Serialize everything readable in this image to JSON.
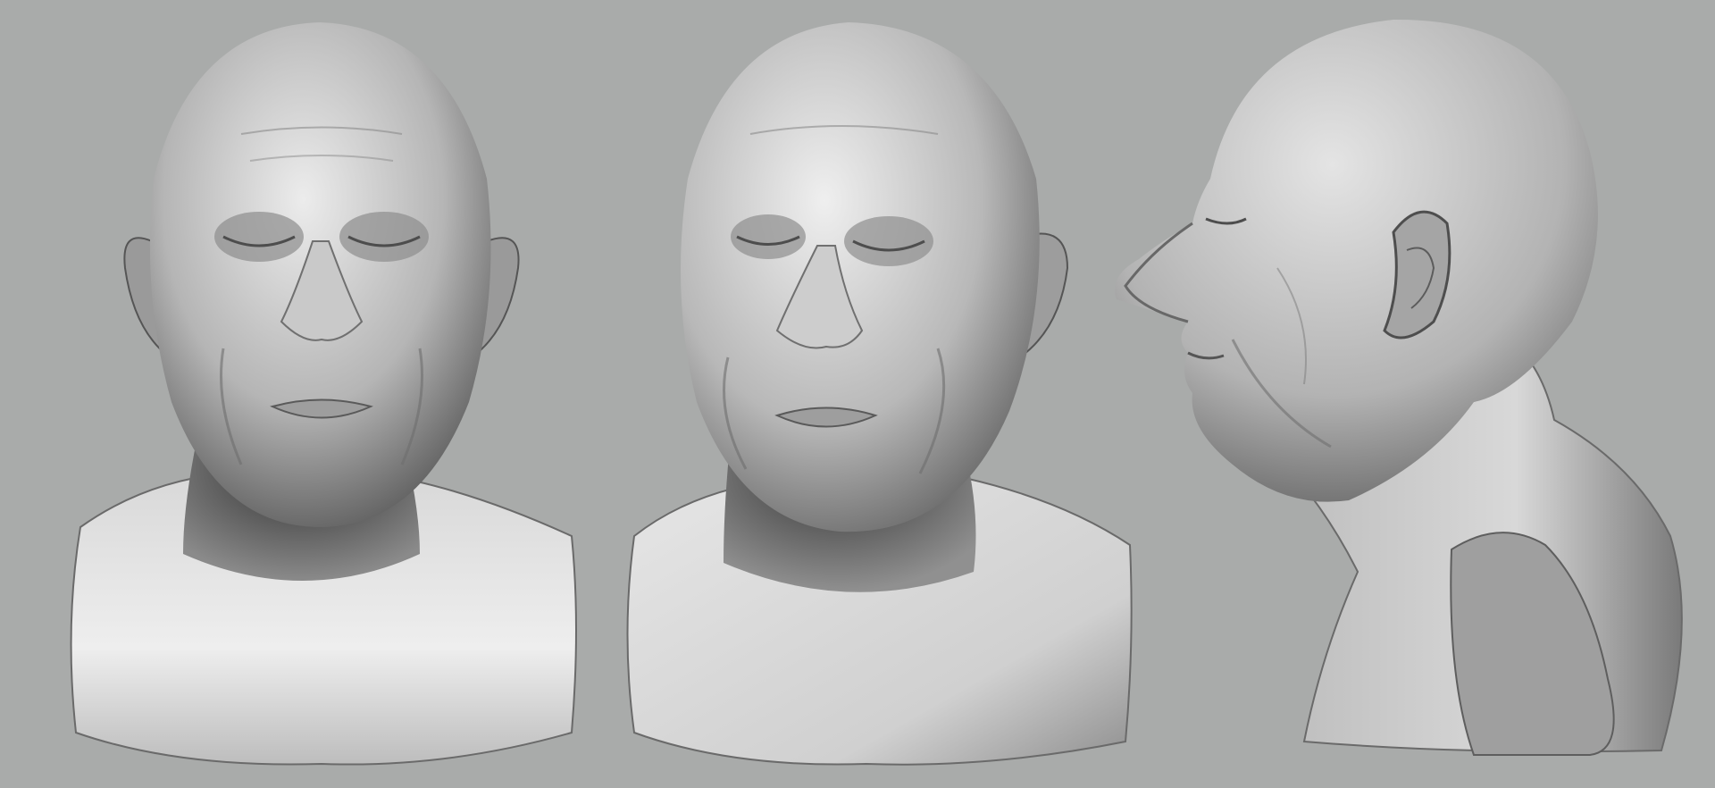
{
  "scene": {
    "background_color": "#a9abaa",
    "material_highlight": "#f2f2f2",
    "material_mid": "#b9b9b9",
    "material_shadow": "#3e3e3e"
  },
  "busts": [
    {
      "view": "front",
      "icon": "sculpted-head-front"
    },
    {
      "view": "three-quarter",
      "icon": "sculpted-head-three-quarter"
    },
    {
      "view": "profile",
      "icon": "sculpted-head-profile"
    }
  ]
}
